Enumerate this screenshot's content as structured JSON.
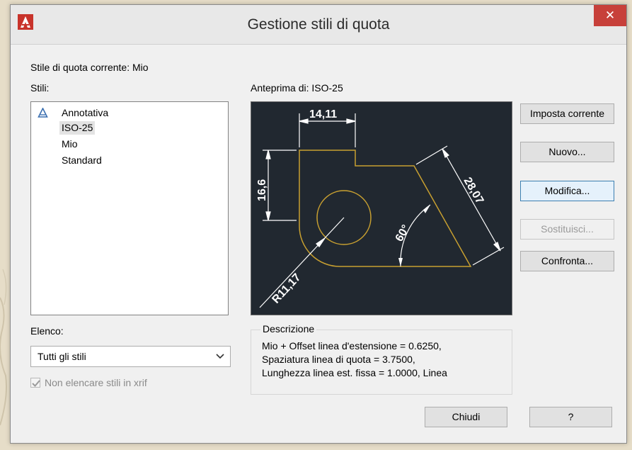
{
  "dialog": {
    "title": "Gestione stili di quota",
    "close_label": "✕",
    "current_style": "Stile di quota corrente: Mio",
    "styles_label": "Stili:",
    "styles": [
      {
        "label": "Annotativa",
        "annotative": true,
        "selected": false
      },
      {
        "label": "ISO-25",
        "annotative": false,
        "selected": true
      },
      {
        "label": "Mio",
        "annotative": false,
        "selected": false
      },
      {
        "label": "Standard",
        "annotative": false,
        "selected": false
      }
    ],
    "preview_label": "Anteprima di: ISO-25",
    "preview": {
      "dim_top": "14,11",
      "dim_left": "16,6",
      "dim_angle": "60°",
      "dim_diag": "28,07",
      "dim_radius": "R11,17"
    },
    "list_label": "Elenco:",
    "list_value": "Tutti gli stili",
    "exclude_xref": {
      "label": "Non elencare stili in xrif",
      "checked": true
    },
    "buttons": {
      "set_current": "Imposta corrente",
      "new": "Nuovo...",
      "modify": "Modifica...",
      "override": "Sostituisci...",
      "compare": "Confronta..."
    },
    "description": {
      "legend": "Descrizione",
      "lines": [
        "Mio + Offset linea d'estensione = 0.6250,",
        "Spaziatura linea di quota = 3.7500,",
        "Lunghezza linea est. fissa = 1.0000, Linea"
      ]
    },
    "close_button": "Chiudi",
    "help_button": "?"
  },
  "colors": {
    "preview_bg": "#212830",
    "geometry": "#c8a030",
    "dimension": "#ffffff",
    "close_red": "#c7403a"
  }
}
